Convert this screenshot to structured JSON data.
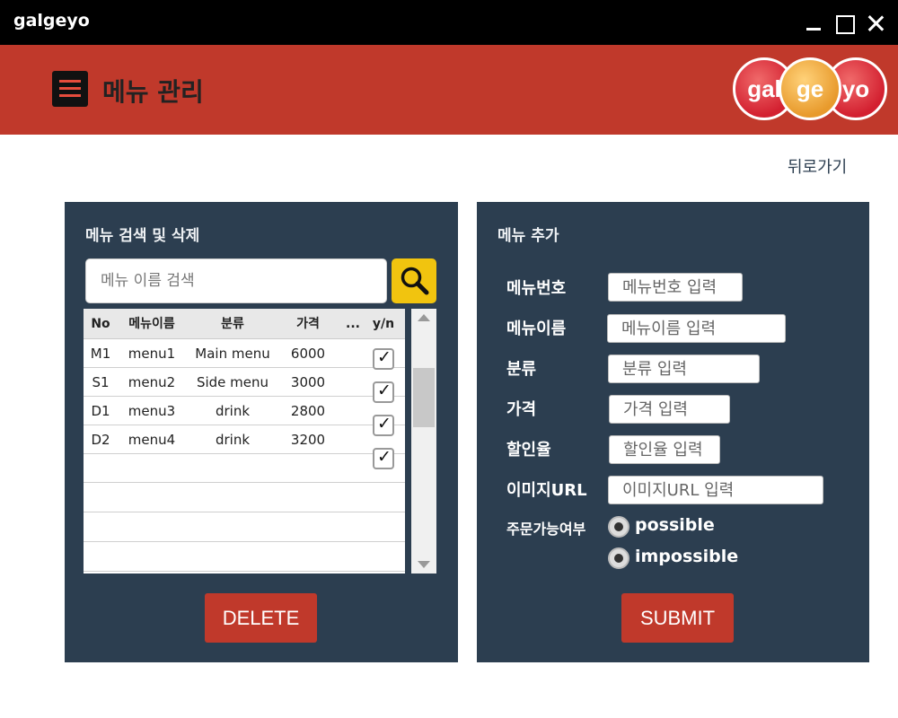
{
  "window": {
    "title": "galgeyo"
  },
  "header": {
    "title": "메뉴 관리",
    "logo": [
      "gal",
      "ge",
      "yo"
    ]
  },
  "nav": {
    "back_label": "뒤로가기"
  },
  "search_panel": {
    "title": "메뉴 검색 및 삭제",
    "search_placeholder": "메뉴 이름 검색",
    "columns": [
      "No",
      "메뉴이름",
      "분류",
      "가격",
      "...",
      "y/n"
    ],
    "rows": [
      {
        "no": "M1",
        "name": "menu1",
        "category": "Main menu",
        "price": "6000",
        "checked": true
      },
      {
        "no": "S1",
        "name": "menu2",
        "category": "Side menu",
        "price": "3000",
        "checked": true
      },
      {
        "no": "D1",
        "name": "menu3",
        "category": "drink",
        "price": "2800",
        "checked": true
      },
      {
        "no": "D2",
        "name": "menu4",
        "category": "drink",
        "price": "3200",
        "checked": true
      }
    ],
    "delete_label": "DELETE"
  },
  "add_panel": {
    "title": "메뉴 추가",
    "fields": {
      "number": {
        "label": "메뉴번호",
        "placeholder": "메뉴번호 입력"
      },
      "name": {
        "label": "메뉴이름",
        "placeholder": "메뉴이름 입력"
      },
      "category": {
        "label": "분류",
        "placeholder": "분류 입력"
      },
      "price": {
        "label": "가격",
        "placeholder": "가격 입력"
      },
      "discount": {
        "label": "할인율",
        "placeholder": "할인율 입력"
      },
      "image_url": {
        "label": "이미지URL",
        "placeholder": "이미지URL 입력"
      }
    },
    "availability": {
      "label": "주문가능여부",
      "options": [
        "possible",
        "impossible"
      ]
    },
    "submit_label": "SUBMIT"
  },
  "colors": {
    "header_red": "#c0392b",
    "panel_navy": "#2c3e50",
    "search_yellow": "#f1c40f"
  }
}
